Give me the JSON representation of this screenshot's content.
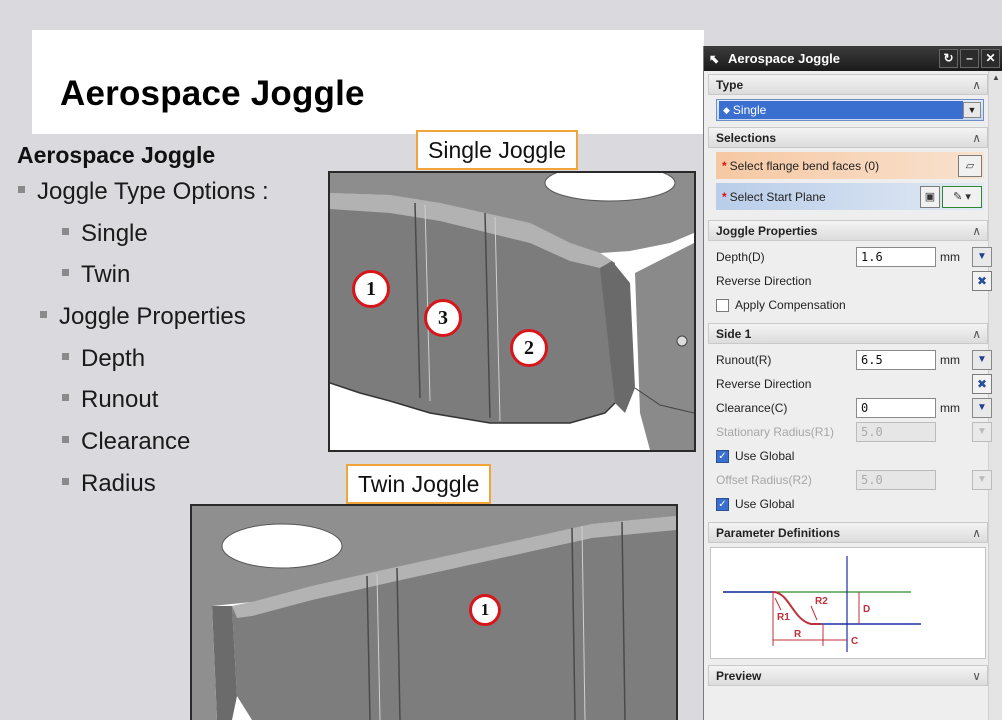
{
  "slide": {
    "title": "Aerospace Joggle",
    "subheading": "Aerospace Joggle",
    "bullets": {
      "type_options": "Joggle Type Options :",
      "single": "Single",
      "twin": "Twin",
      "properties": "Joggle Properties",
      "depth": "Depth",
      "runout": "Runout",
      "clearance": "Clearance",
      "radius": "Radius"
    },
    "callouts": {
      "single": "Single Joggle",
      "twin": "Twin Joggle"
    },
    "markers": {
      "single_1": "1",
      "single_3": "3",
      "single_2": "2",
      "twin_1": "1"
    }
  },
  "dialog": {
    "title": "Aerospace Joggle",
    "type": {
      "header": "Type",
      "selected": "Single"
    },
    "selections": {
      "header": "Selections",
      "flange": "Select flange bend faces (0)",
      "start_plane": "Select Start Plane"
    },
    "joggle_properties": {
      "header": "Joggle Properties",
      "depth_label": "Depth(D)",
      "depth_value": "1.6",
      "depth_unit": "mm",
      "reverse": "Reverse Direction",
      "apply_comp": "Apply Compensation"
    },
    "side1": {
      "header": "Side 1",
      "runout_label": "Runout(R)",
      "runout_value": "6.5",
      "runout_unit": "mm",
      "reverse": "Reverse Direction",
      "clearance_label": "Clearance(C)",
      "clearance_value": "0",
      "clearance_unit": "mm",
      "stat_radius_label": "Stationary Radius(R1)",
      "stat_radius_value": "5.0",
      "use_global_1": "Use Global",
      "offset_radius_label": "Offset Radius(R2)",
      "offset_radius_value": "5.0",
      "use_global_2": "Use Global"
    },
    "param_defs": {
      "header": "Parameter Definitions",
      "labels": {
        "r1": "R1",
        "r2": "R2",
        "d": "D",
        "r": "R",
        "c": "C"
      }
    },
    "preview": {
      "header": "Preview"
    }
  },
  "colors": {
    "callout_border": "#f0a43a",
    "marker_ring": "#d8151b",
    "dialog_title": "#1a1a1a",
    "selection_orange": "#f6c8a2",
    "selection_blue": "#b9cde9"
  }
}
